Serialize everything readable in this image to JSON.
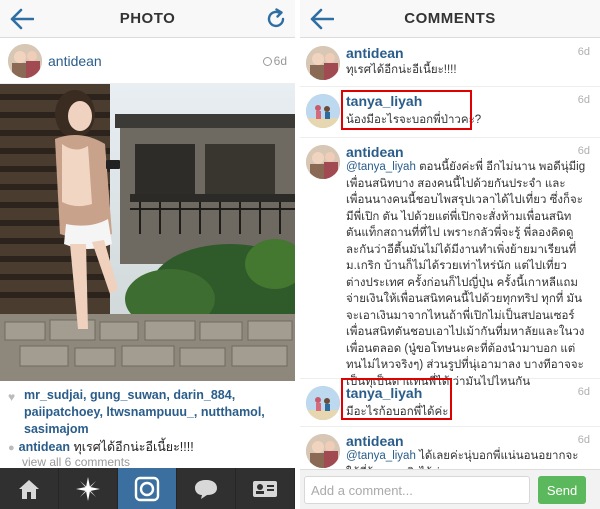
{
  "left": {
    "title": "PHOTO",
    "post": {
      "username": "antidean",
      "time": "6d",
      "likes": "mr_sudjai, gung_suwan, darin_884, paiipatchoey, ltwsnampuuu_, nutthamol, sasimajom",
      "caption_user": "antidean",
      "caption_text": "ทุเรศได้อีกน่ะอีเนี้ยะ!!!!",
      "view_all": "view all 6 comments"
    },
    "tabs": [
      "home-icon",
      "explore-icon",
      "camera-icon",
      "activity-icon",
      "profile-icon"
    ]
  },
  "right": {
    "title": "COMMENTS",
    "comments": [
      {
        "user": "antidean",
        "time": "6d",
        "text": "ทุเรศได้อีกน่ะอีเนี้ยะ!!!!"
      },
      {
        "user": "tanya_liyah",
        "time": "6d",
        "text": "น้องมีอะไรจะบอกพี่ป่าวคะ?"
      },
      {
        "user": "antidean",
        "time": "6d",
        "mention": "@tanya_liyah",
        "text": "ตอนนี้ยังค่ะพี่ อีกไม่นาน พอดีนุ่มีig เพื่อนสนิทบาง สองคนนี้ไปด้วยกันประจำ และเพื่อนนางคนนี้ชอบไพสรุปเวลาได้ไปเที่ยว ซึ่งก็จะมีพี่เปิก ตัน ไปด้วยแต่พี่เปิกจะสั่งห้ามเพื่อนสนิทตันแท็กสถานที่ที่ไป เพราะกลัวพี่จะรู้ พี่ลองคิดดูละกันว่าอีตี้นมันไม่ได้มีงานทำเพิ่งย้ายมาเรียนที่ ม.เกริก บ้านก็ไม่ได้รวยเท่าไหร่นัก แต่ไปเที่ยวต่างประเทศ ครั้งก่อนก็ไปญี่ปุ่น ครั้งนี้เกาหลีแถมจ่ายเงินให้เพื่อนสนิทคนนี้ไปด้วยทุกทริป ทุกที่ มันจะเอาเงินมาจากไหนถ้าพี่เปิกไม่เป็นสปอนเซอร์ เพื่อนสนิทตันชอบเอาไปเม้ากันที่มหาลัยและในวงเพื่อนตลอด (นู๋ขอโทษนะคะที่ต้องนำมาบอก แต่ทนไม่ไหวจริงๆ) ส่วนรูปที่นุ่เอามาลง บางทีอาจจะเป็นทุเป็นตาแทนพี่ได้ ว่ามันไปไหนกัน"
      },
      {
        "user": "tanya_liyah",
        "time": "6d",
        "text": "มีอะไรก้อบอกพี่ได้ค่ะ"
      },
      {
        "user": "antidean",
        "time": "6d",
        "mention": "@tanya_liyah",
        "text": "ได้เลยค่ะนุ่บอกพี่แน่นอนอยากจะให้พี่รู้ความจริงไว้ค่ะ"
      }
    ],
    "composer": {
      "placeholder": "Add a comment...",
      "send": "Send"
    }
  },
  "colors": {
    "link": "#2a5d8a",
    "send": "#5cb85c",
    "tabbar": "#303030",
    "tab_active": "#3b6fa0",
    "highlight": "#e10000"
  }
}
